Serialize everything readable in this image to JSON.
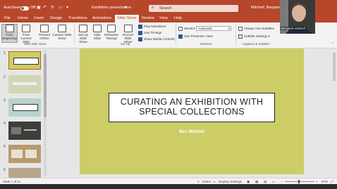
{
  "titlebar": {
    "autosave_label": "AutoSave",
    "autosave_state": "Off",
    "document_title": "Exhibition presentation",
    "search_placeholder": "Search",
    "user_name": "Mitchell, Benjamin"
  },
  "tabs": [
    "File",
    "Home",
    "Insert",
    "Design",
    "Transitions",
    "Animations",
    "Slide Show",
    "Review",
    "View",
    "Help"
  ],
  "active_tab": "Slide Show",
  "ribbon": {
    "start": {
      "from_beginning": "From\nBeginning",
      "from_current": "From\nCurrent Slide",
      "present_online": "Present\nOnline",
      "custom_show": "Custom Slide\nShow",
      "group": "Start Slide Show"
    },
    "setup": {
      "set_up": "Set Up\nSlide Show",
      "hide": "Hide\nSlide",
      "rehearse": "Rehearse\nTimings",
      "record": "Record Slide\nShow",
      "play_narrations": "Play Narrations",
      "use_timings": "Use Timings",
      "show_media": "Show Media Controls",
      "group": "Set Up"
    },
    "monitors": {
      "monitor_label": "Monitor:",
      "monitor_value": "Automatic",
      "presenter_view": "Use Presenter View",
      "group": "Monitors"
    },
    "captions": {
      "always_subtitles": "Always Use Subtitles",
      "subtitle_settings": "Subtitle Settings",
      "group": "Captions & Subtitles"
    }
  },
  "thumbnails": [
    {
      "num": "1",
      "bg": "#cccd66"
    },
    {
      "num": "2",
      "bg": "#d3d6b3"
    },
    {
      "num": "3",
      "bg": "#b7d3cc"
    },
    {
      "num": "4",
      "bg": "#3e3e3a"
    },
    {
      "num": "5",
      "bg": "#b89a6e"
    },
    {
      "num": "6",
      "bg": "#b8a58a"
    }
  ],
  "slide": {
    "title": "CURATING AN EXHIBITION WITH SPECIAL COLLECTIONS",
    "subtitle": "Ben Mitchell",
    "background": "#cccd66"
  },
  "statusbar": {
    "slide_count": "Slide 1 of 11",
    "notes": "Notes",
    "display_settings": "Display Settings",
    "zoom": "87%"
  },
  "webcam": {
    "name": "Benjamin Mitchell"
  },
  "colors": {
    "accent": "#b7472a",
    "ribbon_bg": "#f3f3f3"
  }
}
